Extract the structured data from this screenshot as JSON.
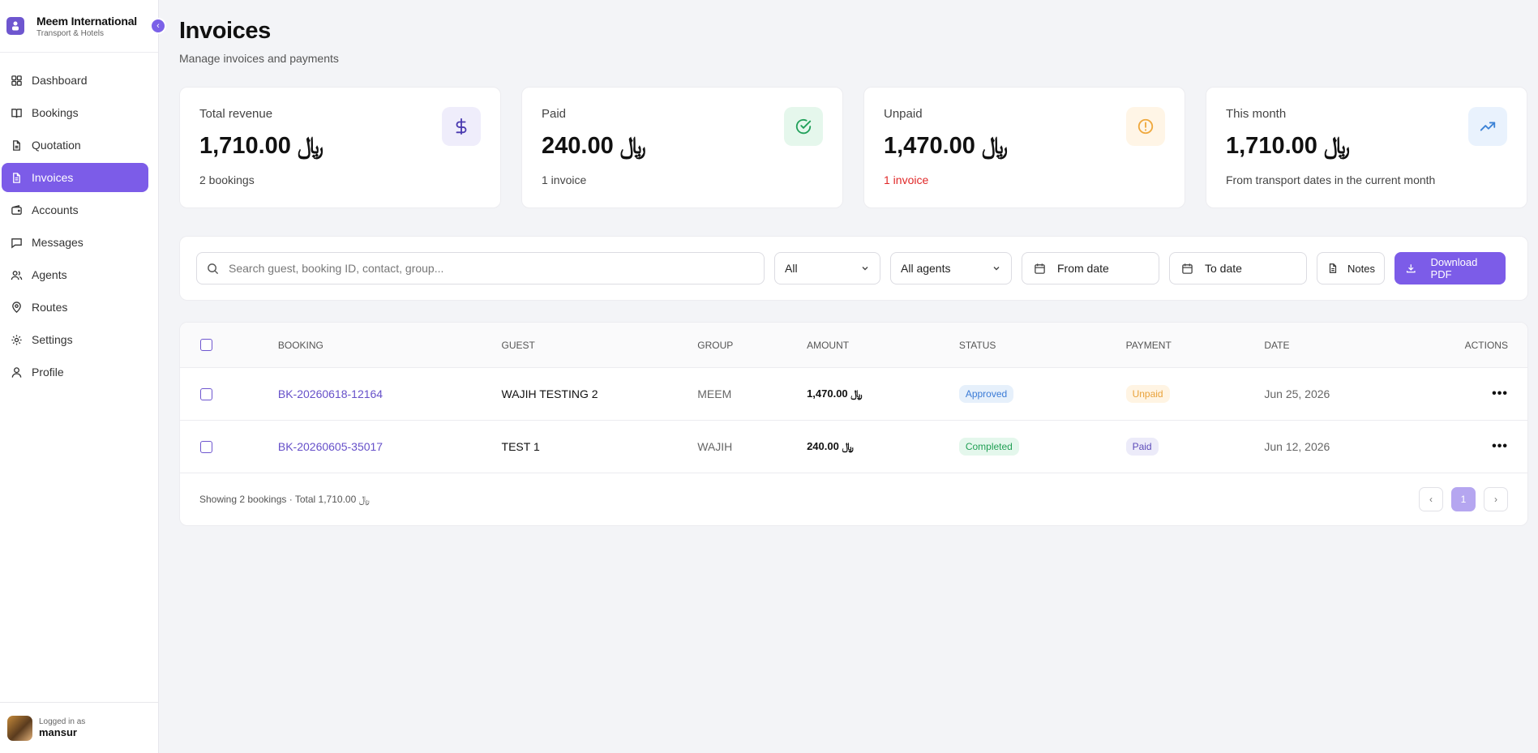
{
  "brand": {
    "name": "Meem International",
    "subtitle": "Transport & Hotels",
    "collapse_icon": "‹"
  },
  "sidebar": {
    "items": [
      {
        "label": "Dashboard",
        "icon": "grid-icon"
      },
      {
        "label": "Bookings",
        "icon": "book-icon"
      },
      {
        "label": "Quotation",
        "icon": "document-icon"
      },
      {
        "label": "Invoices",
        "icon": "invoice-icon",
        "active": true
      },
      {
        "label": "Accounts",
        "icon": "wallet-icon"
      },
      {
        "label": "Messages",
        "icon": "message-icon"
      },
      {
        "label": "Agents",
        "icon": "users-icon"
      },
      {
        "label": "Routes",
        "icon": "map-pin-icon"
      },
      {
        "label": "Settings",
        "icon": "gear-icon"
      },
      {
        "label": "Profile",
        "icon": "user-icon"
      }
    ],
    "footer": {
      "label": "Logged in as",
      "user": "mansur"
    }
  },
  "header": {
    "title": "Invoices",
    "subtitle": "Manage invoices and payments"
  },
  "stats": [
    {
      "label": "Total revenue",
      "value": "﷼ 1,710.00",
      "note": "2 bookings",
      "icon": "dollar-icon",
      "icon_color": "#4a3ab0",
      "icon_bg": "#efedfb"
    },
    {
      "label": "Paid",
      "value": "﷼ 240.00",
      "note": "1 invoice",
      "icon": "check-circle-icon",
      "icon_color": "#21a05a",
      "icon_bg": "#e5f7ec"
    },
    {
      "label": "Unpaid",
      "value": "﷼ 1,470.00",
      "note": "1 invoice",
      "note_color": "#e02828",
      "icon": "alert-circle-icon",
      "icon_color": "#efa83d",
      "icon_bg": "#fff5e6"
    },
    {
      "label": "This month",
      "value": "﷼ 1,710.00",
      "note": "From transport dates in the current month",
      "icon": "trending-up-icon",
      "icon_color": "#3b82d6",
      "icon_bg": "#e9f2fd"
    }
  ],
  "filters": {
    "search_placeholder": "Search guest, booking ID, contact, group...",
    "status_select": "All",
    "agent_select": "All agents",
    "from_date": "From date",
    "to_date": "To date",
    "notes_label": "Notes",
    "download_label": "Download PDF"
  },
  "table": {
    "columns": [
      "BOOKING",
      "GUEST",
      "GROUP",
      "AMOUNT",
      "STATUS",
      "PAYMENT",
      "DATE",
      "ACTIONS"
    ],
    "rows": [
      {
        "booking": "BK-20260618-12164",
        "guest": "WAJIH TESTING 2",
        "group": "MEEM",
        "amount": "﷼ 1,470.00",
        "status": "Approved",
        "payment": "Unpaid",
        "date": "Jun 25, 2026",
        "actions": "•••"
      },
      {
        "booking": "BK-20260605-35017",
        "guest": "TEST 1",
        "group": "WAJIH",
        "amount": "﷼ 240.00",
        "status": "Completed",
        "payment": "Paid",
        "date": "Jun 12, 2026",
        "actions": "•••"
      }
    ],
    "footer_text": "Showing 2 bookings · Total ﷼ 1,710.00",
    "pagination": {
      "prev": "‹",
      "current": "1",
      "next": "›"
    }
  }
}
